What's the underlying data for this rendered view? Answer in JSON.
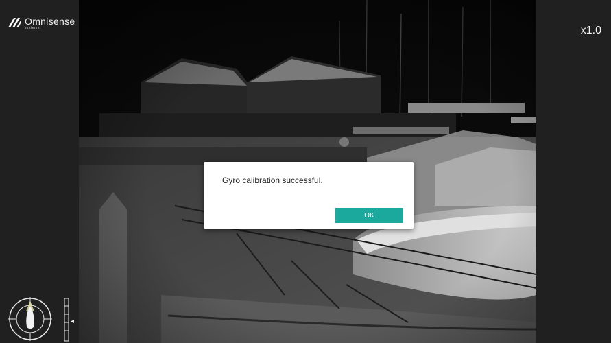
{
  "brand": {
    "name": "Omnisense",
    "sub": "systems"
  },
  "zoom_level": "x1.0",
  "dialog": {
    "message": "Gyro calibration successful.",
    "ok_label": "OK"
  },
  "colors": {
    "accent": "#1aa99c",
    "panel": "#202020",
    "compass_pointer": "#e8e4a8"
  },
  "icons": {
    "logo": "omnisense-logo-icon",
    "compass": "compass-icon",
    "tilt": "tilt-scale-icon"
  }
}
